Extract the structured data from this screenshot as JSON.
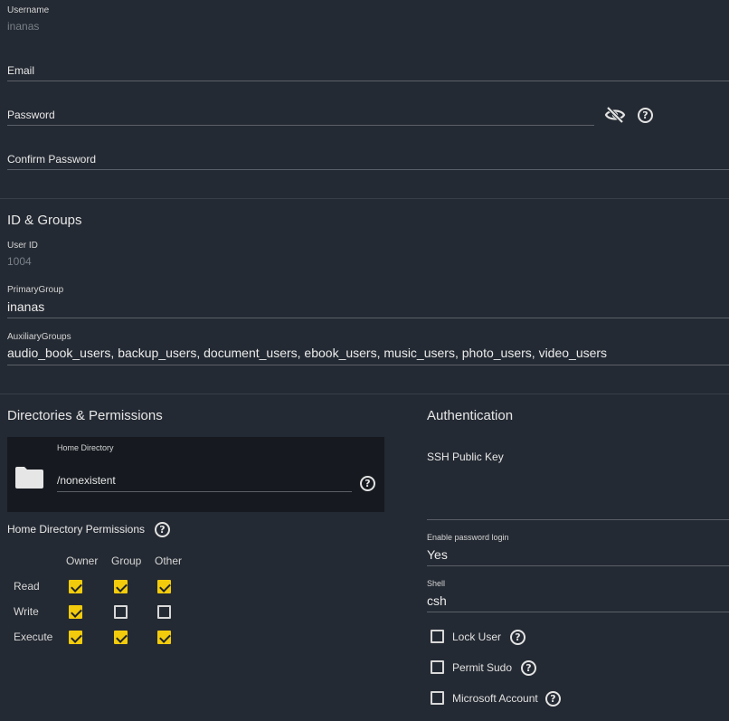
{
  "account": {
    "username_label": "Username",
    "username_value": "inanas",
    "email_label": "Email",
    "password_label": "Password",
    "confirm_password_label": "Confirm Password"
  },
  "id_groups": {
    "title": "ID & Groups",
    "user_id_label": "User ID",
    "user_id_value": "1004",
    "primary_group_label": "PrimaryGroup",
    "primary_group_value": "inanas",
    "aux_groups_label": "AuxiliaryGroups",
    "aux_groups_value": "audio_book_users, backup_users, document_users, ebook_users, music_users, photo_users, video_users"
  },
  "directories": {
    "title": "Directories & Permissions",
    "home_dir_label": "Home Directory",
    "home_dir_value": "/nonexistent",
    "permissions_label": "Home Directory Permissions",
    "columns": [
      "Owner",
      "Group",
      "Other"
    ],
    "rows": [
      {
        "label": "Read",
        "values": [
          true,
          true,
          true
        ]
      },
      {
        "label": "Write",
        "values": [
          true,
          false,
          false
        ]
      },
      {
        "label": "Execute",
        "values": [
          true,
          true,
          true
        ]
      }
    ]
  },
  "authentication": {
    "title": "Authentication",
    "ssh_key_label": "SSH Public Key",
    "password_login_label": "Enable password login",
    "password_login_value": "Yes",
    "shell_label": "Shell",
    "shell_value": "csh",
    "lock_user_label": "Lock User",
    "permit_sudo_label": "Permit Sudo",
    "microsoft_account_label": "Microsoft Account"
  },
  "colors": {
    "background": "#242a33",
    "panel": "#161a20",
    "accent": "#f2cc0c"
  }
}
